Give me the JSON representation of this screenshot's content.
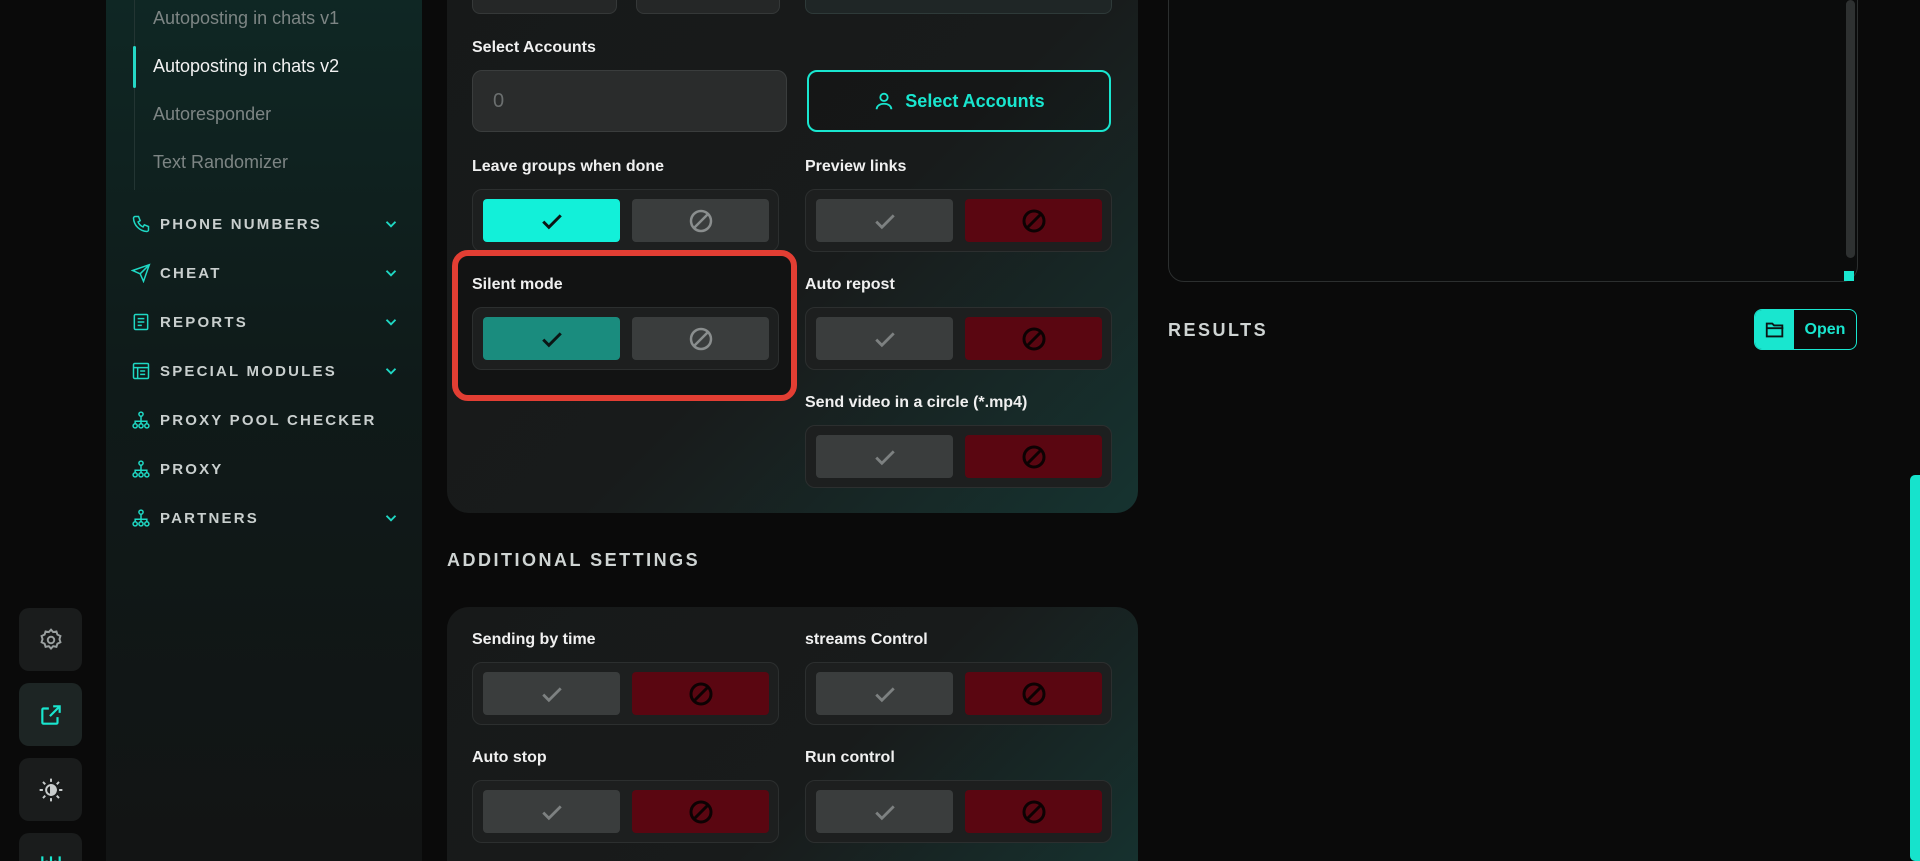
{
  "sidebar": {
    "sub_items": [
      "Autoposting in chats v1",
      "Autoposting in chats v2",
      "Autoresponder",
      "Text Randomizer"
    ],
    "nav": [
      {
        "label": "PHONE NUMBERS",
        "icon": "phone-icon",
        "has_chevron": true
      },
      {
        "label": "CHEAT",
        "icon": "send-icon",
        "has_chevron": true
      },
      {
        "label": "REPORTS",
        "icon": "document-icon",
        "has_chevron": true
      },
      {
        "label": "SPECIAL MODULES",
        "icon": "modules-icon",
        "has_chevron": true
      },
      {
        "label": "PROXY POOL CHECKER",
        "icon": "network-icon",
        "has_chevron": false
      },
      {
        "label": "PROXY",
        "icon": "network-icon",
        "has_chevron": false
      },
      {
        "label": "PARTNERS",
        "icon": "network-icon",
        "has_chevron": true
      }
    ]
  },
  "rail": {
    "icons": [
      "gear-icon",
      "external-link-icon",
      "theme-icon",
      "logo-icon"
    ]
  },
  "main": {
    "select_accounts_label": "Select Accounts",
    "accounts_value": "0",
    "select_accounts_button": "Select Accounts",
    "toggles": {
      "leave_groups": {
        "label": "Leave groups when done",
        "state": "yes"
      },
      "preview_links": {
        "label": "Preview links",
        "state": "no"
      },
      "silent_mode": {
        "label": "Silent mode",
        "state": "yes"
      },
      "auto_repost": {
        "label": "Auto repost",
        "state": "no"
      },
      "send_video_circle": {
        "label": "Send video in a circle (*.mp4)",
        "state": "no"
      }
    },
    "additional_settings_title": "ADDITIONAL SETTINGS",
    "additional": {
      "sending_by_time": {
        "label": "Sending by time",
        "state": "no"
      },
      "streams_control": {
        "label": "streams Control",
        "state": "no"
      },
      "auto_stop": {
        "label": "Auto stop",
        "state": "no"
      },
      "run_control": {
        "label": "Run control",
        "state": "no"
      }
    }
  },
  "results": {
    "title": "RESULTS",
    "open_label": "Open"
  },
  "colors": {
    "accent": "#19e6cf",
    "no_active": "#5a0611",
    "highlight": "#e23e33"
  }
}
